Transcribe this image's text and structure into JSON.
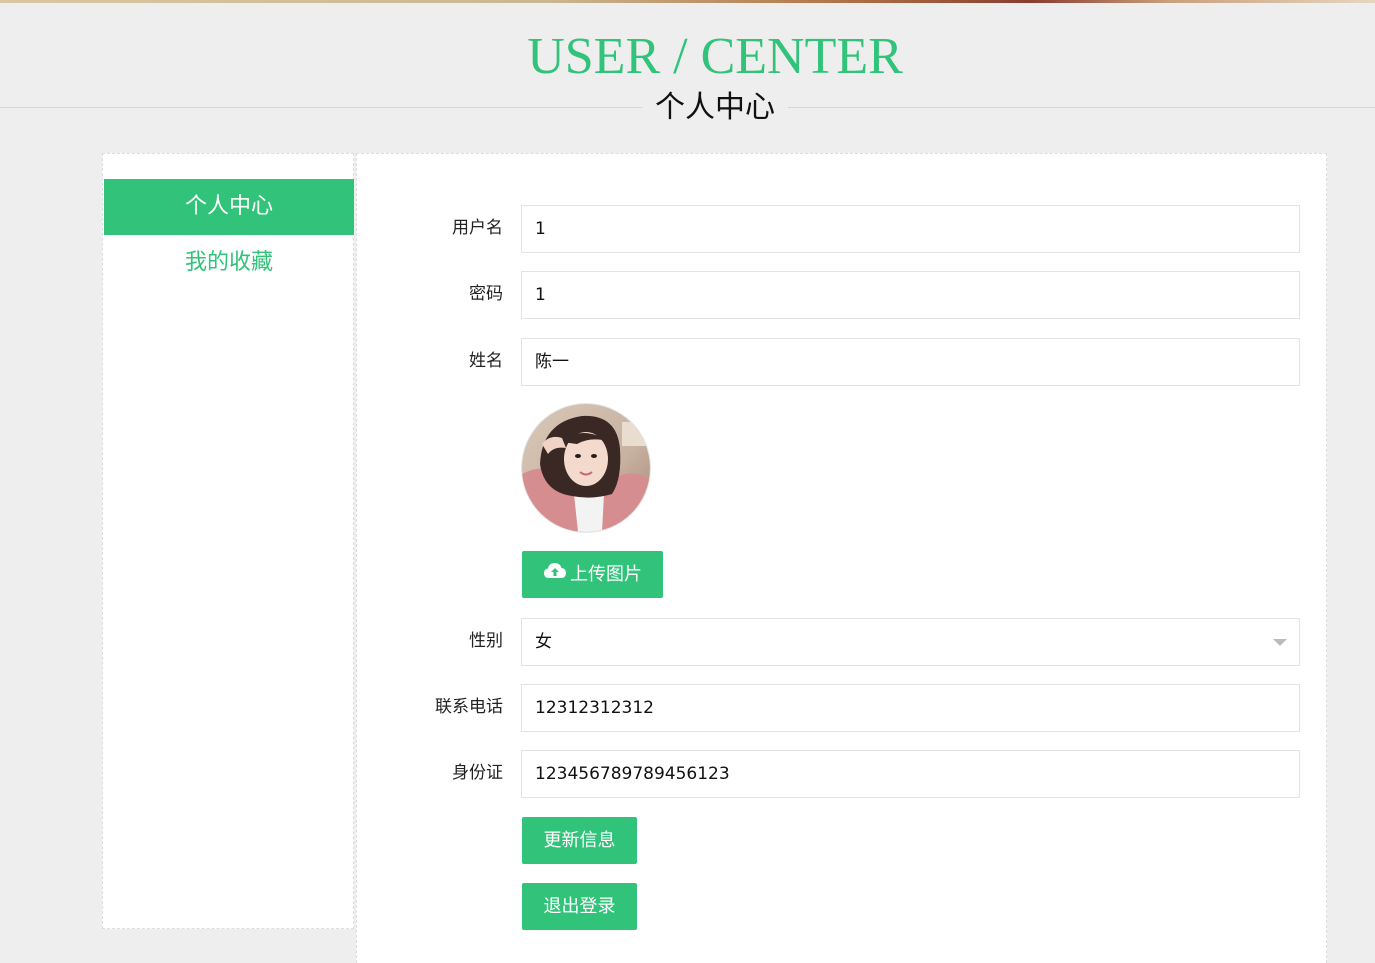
{
  "header": {
    "title_en": "USER / CENTER",
    "title_cn": "个人中心"
  },
  "sidebar": {
    "items": [
      {
        "label": "个人中心",
        "active": true
      },
      {
        "label": "我的收藏",
        "active": false
      }
    ]
  },
  "form": {
    "username": {
      "label": "用户名",
      "value": "1"
    },
    "password": {
      "label": "密码",
      "value": "1"
    },
    "name": {
      "label": "姓名",
      "value": "陈一"
    },
    "gender": {
      "label": "性别",
      "value": "女"
    },
    "phone": {
      "label": "联系电话",
      "value": "12312312312"
    },
    "id_card": {
      "label": "身份证",
      "value": "123456789789456123"
    }
  },
  "buttons": {
    "upload_label": "上传图片",
    "update_label": "更新信息",
    "logout_label": "退出登录"
  },
  "icons": {
    "upload": "cloud-upload-icon",
    "select_arrow": "caret-down-icon"
  },
  "colors": {
    "accent": "#32c37a",
    "background": "#eeeeee"
  }
}
